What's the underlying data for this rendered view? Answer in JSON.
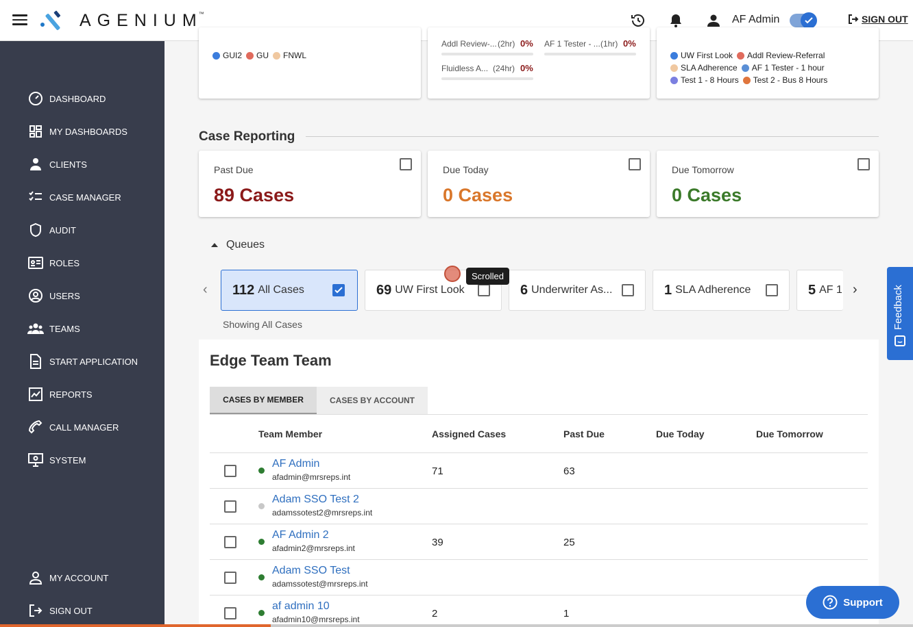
{
  "header": {
    "brand": "AGENIUM",
    "brand_tm": "™",
    "user": "AF Admin",
    "sign_out": "SIGN OUT"
  },
  "sidebar": {
    "items": [
      {
        "label": "DASHBOARD",
        "icon": "dashboard-icon"
      },
      {
        "label": "MY DASHBOARDS",
        "icon": "grid-icon"
      },
      {
        "label": "CLIENTS",
        "icon": "person-icon"
      },
      {
        "label": "CASE MANAGER",
        "icon": "checklist-icon"
      },
      {
        "label": "AUDIT",
        "icon": "shield-icon"
      },
      {
        "label": "ROLES",
        "icon": "id-card-icon"
      },
      {
        "label": "USERS",
        "icon": "user-circle-icon"
      },
      {
        "label": "TEAMS",
        "icon": "group-icon"
      },
      {
        "label": "START APPLICATION",
        "icon": "document-icon"
      },
      {
        "label": "REPORTS",
        "icon": "chart-icon"
      },
      {
        "label": "CALL MANAGER",
        "icon": "phone-icon"
      },
      {
        "label": "SYSTEM",
        "icon": "monitor-icon"
      }
    ],
    "bottom": [
      {
        "label": "MY ACCOUNT",
        "icon": "account-icon"
      },
      {
        "label": "SIGN OUT",
        "icon": "logout-icon"
      }
    ]
  },
  "top_cards": {
    "left_legend": [
      {
        "label": "GUI2",
        "color": "#3b7ddd"
      },
      {
        "label": "GU",
        "color": "#e06b5d"
      },
      {
        "label": "FNWL",
        "color": "#f0c8a0"
      }
    ],
    "middle_bars": [
      {
        "label": "Addl Review-...",
        "time": "(2hr)",
        "value": "0%"
      },
      {
        "label": "AF 1 Tester - ...",
        "time": "(1hr)",
        "value": "0%"
      },
      {
        "label": "Fluidless A...",
        "time": "(24hr)",
        "value": "0%"
      }
    ],
    "right_legend": [
      [
        {
          "label": "UW First Look",
          "color": "#3b7ddd"
        },
        {
          "label": "Addl Review-Referral",
          "color": "#e06b5d"
        }
      ],
      [
        {
          "label": "SLA Adherence",
          "color": "#f0c8a0"
        },
        {
          "label": "AF 1 Tester - 1 hour",
          "color": "#5a8fd6"
        }
      ],
      [
        {
          "label": "Test 1 - 8 Hours",
          "color": "#7b7fe0"
        },
        {
          "label": "Test 2 - Bus 8 Hours",
          "color": "#e0763d"
        }
      ]
    ]
  },
  "case_reporting": {
    "title": "Case Reporting",
    "cards": [
      {
        "label": "Past Due",
        "value": "89 Cases",
        "color": "#8b1a1a"
      },
      {
        "label": "Due Today",
        "value": "0 Cases",
        "color": "#d9772b"
      },
      {
        "label": "Due Tomorrow",
        "value": "0 Cases",
        "color": "#3b7a2a"
      }
    ]
  },
  "queues": {
    "title": "Queues",
    "items": [
      {
        "count": "112",
        "name": "All Cases",
        "checked": true
      },
      {
        "count": "69",
        "name": "UW First Look",
        "checked": false
      },
      {
        "count": "6",
        "name": "Underwriter As...",
        "checked": false
      },
      {
        "count": "1",
        "name": "SLA Adherence",
        "checked": false
      },
      {
        "count": "5",
        "name": "AF 1",
        "checked": false
      }
    ],
    "showing": "Showing All Cases",
    "tooltip": "Scrolled"
  },
  "team": {
    "title": "Edge Team Team",
    "tabs": [
      "CASES BY MEMBER",
      "CASES BY ACCOUNT"
    ],
    "columns": [
      "Team Member",
      "Assigned Cases",
      "Past Due",
      "Due Today",
      "Due Tomorrow"
    ],
    "rows": [
      {
        "name": "AF Admin",
        "email": "afadmin@mrsreps.int",
        "assigned": "71",
        "past_due": "63",
        "status": "#2e7d32"
      },
      {
        "name": "Adam SSO Test 2",
        "email": "adamssotest2@mrsreps.int",
        "assigned": "",
        "past_due": "",
        "status": "#c8c8c8"
      },
      {
        "name": "AF Admin 2",
        "email": "afadmin2@mrsreps.int",
        "assigned": "39",
        "past_due": "25",
        "status": "#2e7d32"
      },
      {
        "name": "Adam SSO Test",
        "email": "adamssotest@mrsreps.int",
        "assigned": "",
        "past_due": "",
        "status": "#2e7d32"
      },
      {
        "name": "af admin 10",
        "email": "afadmin10@mrsreps.int",
        "assigned": "2",
        "past_due": "1",
        "status": "#2e7d32"
      }
    ]
  },
  "feedback": "Feedback",
  "support": "Support"
}
